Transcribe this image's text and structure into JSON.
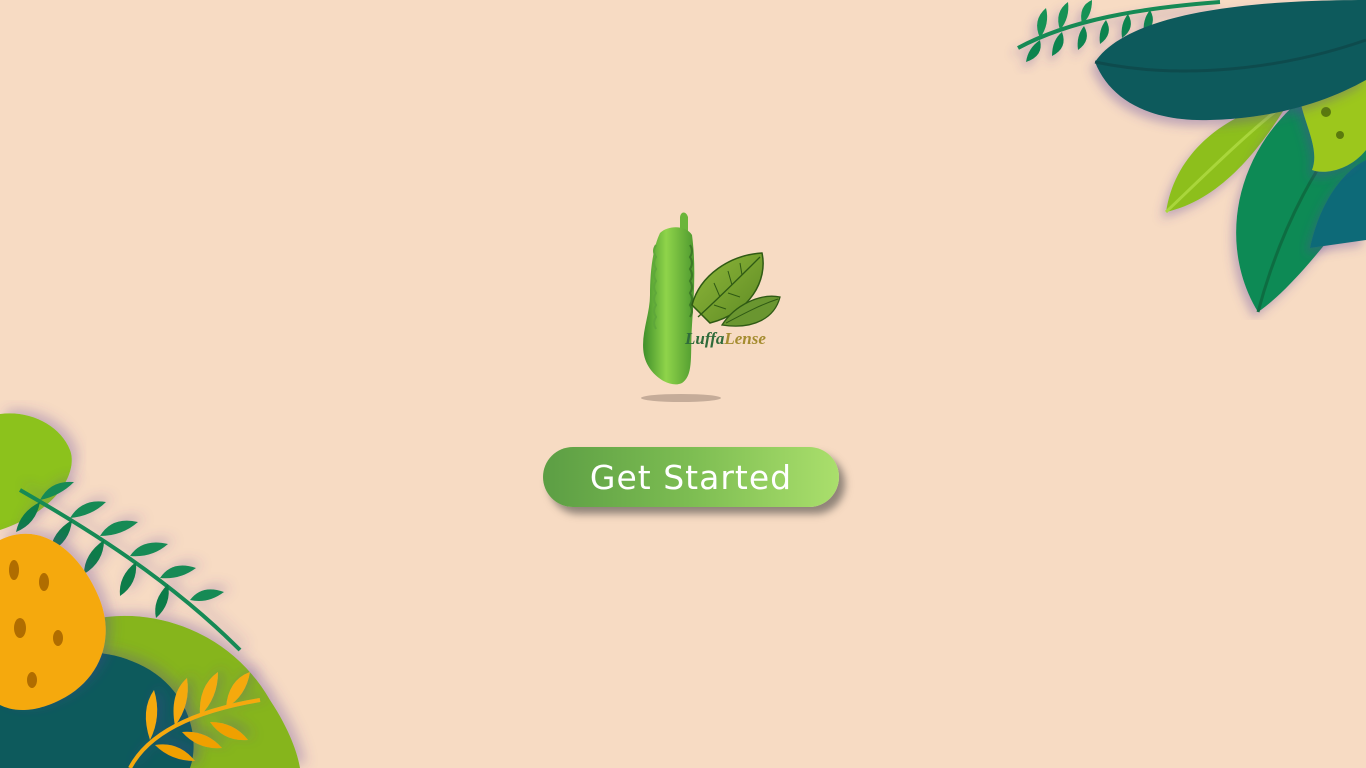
{
  "logo": {
    "brand_part1": "Luffa",
    "brand_part2": "Lense",
    "part1_color": "#2f6b3a",
    "part2_color": "#a58c2f"
  },
  "actions": {
    "get_started_label": "Get Started"
  },
  "colors": {
    "background": "#f7dbc3",
    "button_gradient_start": "#5c9e44",
    "button_gradient_end": "#aadf6c",
    "leaf_dark_teal": "#0e5b5b",
    "leaf_green": "#138a55",
    "leaf_lime": "#8cc21d",
    "leaf_yellow": "#f5a90f"
  },
  "decorations": {
    "top_right": "tropical-leaves",
    "bottom_left": "tropical-leaves"
  }
}
